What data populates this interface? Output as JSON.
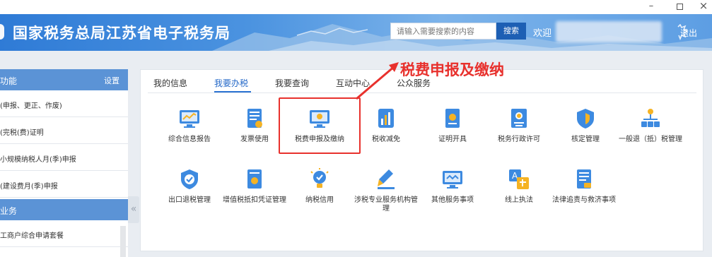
{
  "window": {
    "minimize": "–",
    "close": "×"
  },
  "header": {
    "site_title": "国家税务总局江苏省电子税务局",
    "search_placeholder": "请输入需要搜索的内容",
    "search_button": "搜索",
    "welcome": "欢迎",
    "logout": "退出"
  },
  "sidebar": {
    "section1_title": "功能",
    "settings": "设置",
    "section1_items": [
      "(申报、更正、作废)",
      "(完税(费)证明",
      "小规模纳税人月(季)申报",
      "(建设费月(季)申报"
    ],
    "section2_title": "业务",
    "section2_items": [
      "工商户综合申请套餐"
    ],
    "collapse_glyph": "«"
  },
  "tabs": [
    "我的信息",
    "我要办税",
    "我要查询",
    "互动中心",
    "公众服务"
  ],
  "active_tab": "我要办税",
  "functions_row1": [
    "综合信息报告",
    "发票使用",
    "税费申报及缴纳",
    "税收减免",
    "证明开具",
    "税务行政许可",
    "核定管理",
    "一般退（抵）税管理"
  ],
  "functions_row2": [
    "出口退税管理",
    "增值税抵扣凭证管理",
    "纳税信用",
    "涉税专业服务机构管理",
    "其他服务事项",
    "线上执法",
    "法律追责与救济事项"
  ],
  "annotation": {
    "callout_text": "税费申报及缴纳",
    "color": "#e8312d"
  },
  "colors": {
    "accent": "#2c73d2",
    "sidebar_header": "#5b93d6",
    "icon_blue": "#3d8ae0",
    "icon_yellow": "#f5b324"
  },
  "icons_row1": [
    "monitor-chart-icon",
    "document-icon",
    "monitor-icon",
    "calculator-chart-icon",
    "certificate-icon",
    "license-icon",
    "shield-icon",
    "flowchart-icon"
  ],
  "icons_row2": [
    "shield-check-icon",
    "document-stamp-icon",
    "lightbulb-check-icon",
    "pen-tool-icon",
    "monitor-icon",
    "translate-icon",
    "legal-document-icon"
  ]
}
